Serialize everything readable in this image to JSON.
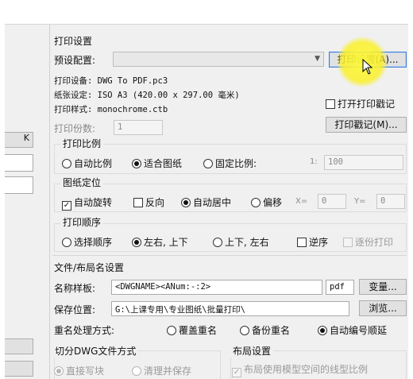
{
  "print_settings": {
    "section_title": "打印设置",
    "preset_label": "预设配置:",
    "preset_value": "",
    "print_setup_button": "打印设置(A)...",
    "device": "打印设备: DWG To PDF.pc3",
    "paper": "纸张设定: ISO A3 (420.00 x 297.00 毫米)",
    "style": "打印样式: monochrome.ctb",
    "open_stamp_label": "打开打印戳记",
    "stamp_button": "打印戳记(M)...",
    "copies_label": "打印份数:",
    "copies_value": "1"
  },
  "scale": {
    "title": "打印比例",
    "options": [
      "自动比例",
      "适合图纸",
      "固定比例:"
    ],
    "selected": 1,
    "ratio_left": "1:",
    "ratio_value": "100"
  },
  "positioning": {
    "title": "图纸定位",
    "auto_rotate": "自动旋转",
    "reverse": "反向",
    "auto_center": "自动居中",
    "offset": "偏移",
    "x_label": "X=",
    "x_value": "0",
    "y_label": "Y=",
    "y_value": "0"
  },
  "order": {
    "title": "打印顺序",
    "options": [
      "选择顺序",
      "左右, 上下",
      "上下, 左右"
    ],
    "selected": 1,
    "reverse_label": "逆序",
    "page_by_page": "逐份打印"
  },
  "file_layout": {
    "section_title": "文件/布局名设置",
    "name_template_label": "名称样板:",
    "name_template_value": "<DWGNAME><ANum:-:2>",
    "ext_value": "pdf",
    "variable_button": "变量...",
    "save_location_label": "保存位置:",
    "save_location_value": "G:\\上课专用\\专业图纸\\批量打印\\",
    "browse_button": "浏览...",
    "rename_label": "重名处理方式:",
    "rename_options": [
      "覆盖重名",
      "备份重名",
      "自动编号顺延"
    ],
    "rename_selected": 2
  },
  "split": {
    "title": "切分DWG文件方式",
    "options": [
      "直接写块",
      "清理并保存"
    ],
    "selected": 0
  },
  "layout": {
    "title": "布局设置",
    "linetype_scale": "布局使用模型空间的线型比例"
  },
  "left_panel": {
    "item_k": "K"
  }
}
